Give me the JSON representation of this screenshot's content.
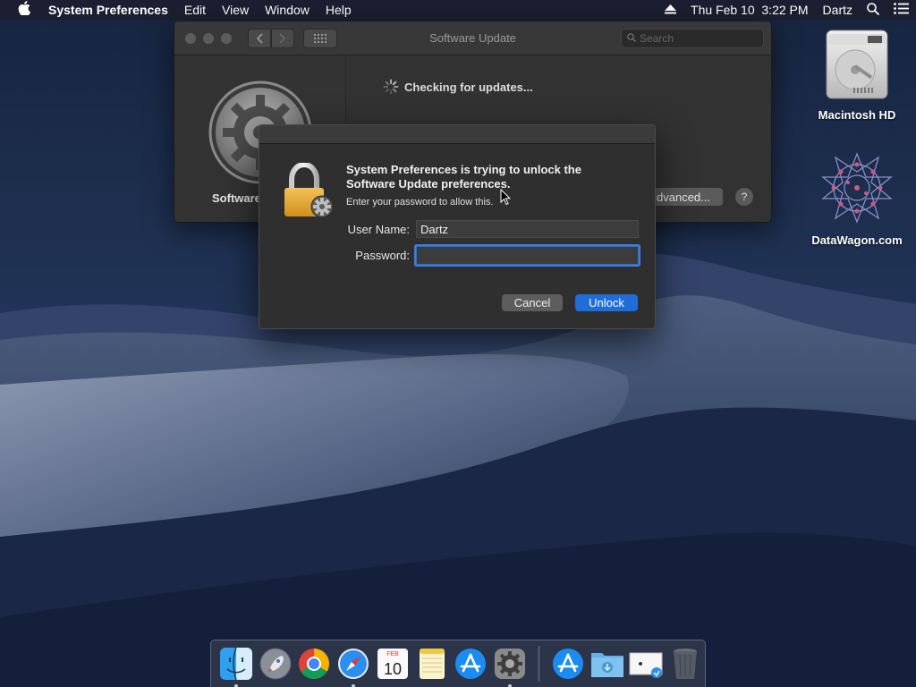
{
  "menubar": {
    "apple_icon": "apple-logo-icon",
    "app_name": "System Preferences",
    "menus": [
      "Edit",
      "View",
      "Window",
      "Help"
    ],
    "datetime": "Thu Feb 10  3:22 PM",
    "user": "Dartz"
  },
  "prefs_window": {
    "title": "Software Update",
    "search_placeholder": "Search",
    "status": "Checking for updates...",
    "sidebar_label": "Software",
    "advanced_label": "dvanced...",
    "help_label": "?"
  },
  "auth_dialog": {
    "heading": "System Preferences is trying to unlock the Software Update preferences.",
    "subtext": "Enter your password to allow this.",
    "username_label": "User Name:",
    "username_value": "Dartz",
    "password_label": "Password:",
    "password_value": "",
    "cancel_label": "Cancel",
    "unlock_label": "Unlock"
  },
  "desktop_icons": [
    {
      "label": "Macintosh HD",
      "icon": "hard-drive-icon"
    },
    {
      "label": "DataWagon.com",
      "icon": "datawagon-logo-icon"
    }
  ],
  "dock": {
    "items": [
      {
        "name": "finder",
        "running": true
      },
      {
        "name": "launchpad",
        "running": false
      },
      {
        "name": "chrome",
        "running": false
      },
      {
        "name": "safari",
        "running": true
      },
      {
        "name": "calendar",
        "running": false,
        "month": "FEB",
        "day": "10"
      },
      {
        "name": "notes",
        "running": false
      },
      {
        "name": "app-store",
        "running": false
      },
      {
        "name": "system-preferences",
        "running": true
      },
      {
        "name": "app-store-downloads",
        "running": false
      },
      {
        "name": "downloads-folder",
        "running": false
      },
      {
        "name": "preview-document",
        "running": false
      },
      {
        "name": "trash",
        "running": false
      }
    ]
  },
  "colors": {
    "accent": "#1f6dd9",
    "dialog_bg": "#2f2f2f",
    "window_bg": "#323232",
    "menubar_bg": "#1c2030"
  }
}
